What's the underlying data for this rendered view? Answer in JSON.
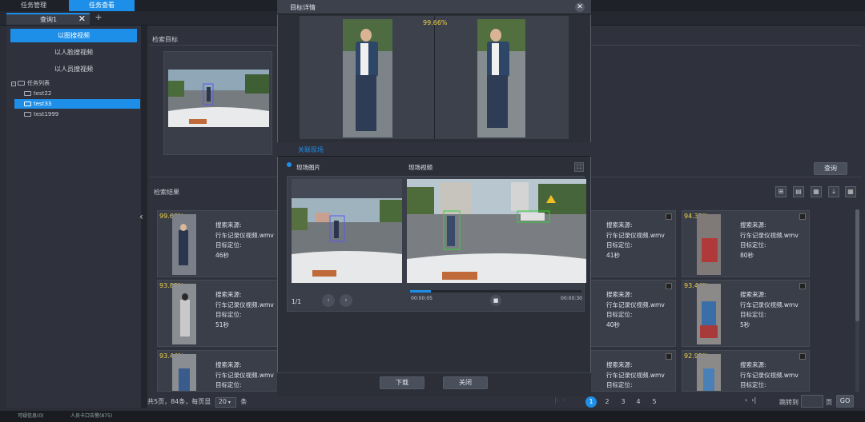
{
  "top_tabs": [
    {
      "label": "任务管理"
    },
    {
      "label": "任务查看"
    }
  ],
  "doc_tab": {
    "label": "查询1",
    "close": "✕",
    "add": "+"
  },
  "left_panel": {
    "buttons": [
      {
        "label": "以图搜视频"
      },
      {
        "label": "以人脸搜视频"
      },
      {
        "label": "以人员搜视频"
      }
    ],
    "tree": {
      "root": "任务列表",
      "items": [
        {
          "label": "test22"
        },
        {
          "label": "test33"
        },
        {
          "label": "test1999"
        }
      ]
    }
  },
  "main": {
    "target_title": "检索目标",
    "results_title": "检索结果",
    "query_button": "查询",
    "collapse": "‹"
  },
  "cards": [
    {
      "pct": "99.66%",
      "source_label": "搜索来源:",
      "source": "行车记录仪视频.wmv",
      "locate_label": "目标定位:",
      "time": "46秒"
    },
    {
      "pct": "93.83%",
      "source_label": "搜索来源:",
      "source": "行车记录仪视频.wmv",
      "locate_label": "目标定位:",
      "time": "51秒"
    },
    {
      "pct": "93.44%",
      "source_label": "搜索来源:",
      "source": "行车记录仪视频.wmv",
      "locate_label": "目标定位:",
      "time": ""
    },
    {
      "pct": "",
      "source_label": "搜索来源:",
      "source": "行车记录仪视频.wmv",
      "locate_label": "目标定位:",
      "time": "41秒"
    },
    {
      "pct": "",
      "source_label": "搜索来源:",
      "source": "行车记录仪视频.wmv",
      "locate_label": "目标定位:",
      "time": "40秒"
    },
    {
      "pct": "",
      "source_label": "搜索来源:",
      "source": "行车记录仪视频.wmv",
      "locate_label": "目标定位:",
      "time": ""
    },
    {
      "pct": "94.35%",
      "source_label": "搜索来源:",
      "source": "行车记录仪视频.wmv",
      "locate_label": "目标定位:",
      "time": "80秒"
    },
    {
      "pct": "93.44%",
      "source_label": "搜索来源:",
      "source": "行车记录仪视频.wmv",
      "locate_label": "目标定位:",
      "time": "5秒"
    },
    {
      "pct": "92.95%",
      "source_label": "搜索来源:",
      "source": "行车记录仪视频.wmv",
      "locate_label": "目标定位:",
      "time": ""
    }
  ],
  "pagination": {
    "summary_prefix": "共5页，84条，每页显",
    "page_size": "20",
    "summary_suffix": "条",
    "pages": [
      "1",
      "2",
      "3",
      "4",
      "5"
    ],
    "current": "1",
    "goto_label": "跳转到",
    "goto_unit": "页",
    "go": "GO"
  },
  "statusbar": {
    "left": "可疑信息(0)",
    "right": "人员卡口告警(875)"
  },
  "modal": {
    "title": "目标详情",
    "close": "✕",
    "score": "99.66%",
    "tab_label": "关联现场",
    "radio_label": "现场图片",
    "video_label": "现场视频",
    "counter": "1/1",
    "time_start": "00:00:05",
    "time_end": "00:00:30",
    "progress": 0.12,
    "download": "下载",
    "close_button": "关闭"
  },
  "colors": {
    "accent": "#1e8fe8",
    "score": "#f0d44a",
    "panel": "#2f323c"
  }
}
